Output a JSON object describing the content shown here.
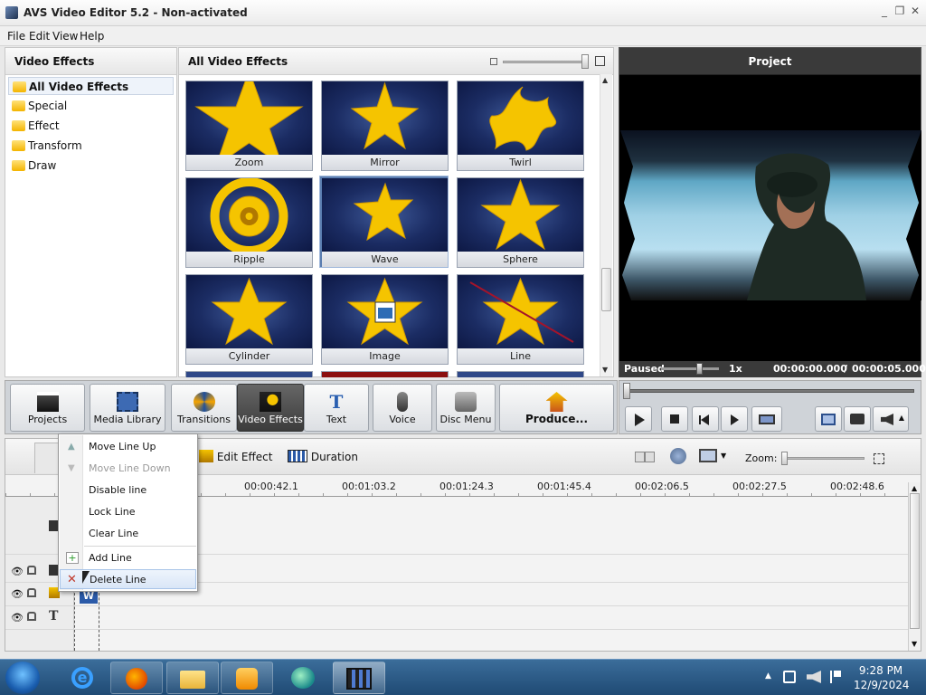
{
  "window": {
    "title": "AVS Video Editor 5.2 - Non-activated",
    "controls": [
      "minimize-icon",
      "restore-icon",
      "close-icon"
    ]
  },
  "menu": {
    "items": [
      "File",
      "Edit",
      "View",
      "Help"
    ]
  },
  "left_panel": {
    "header": "Video Effects",
    "items": [
      {
        "label": "All Video Effects",
        "selected": true
      },
      {
        "label": "Special"
      },
      {
        "label": "Effect"
      },
      {
        "label": "Transform"
      },
      {
        "label": "Draw"
      }
    ]
  },
  "effects_panel": {
    "header": "All Video Effects",
    "tiles": [
      {
        "label": "Zoom"
      },
      {
        "label": "Mirror"
      },
      {
        "label": "Twirl"
      },
      {
        "label": "Ripple"
      },
      {
        "label": "Wave",
        "selected": true
      },
      {
        "label": "Sphere"
      },
      {
        "label": "Cylinder"
      },
      {
        "label": "Image"
      },
      {
        "label": "Line"
      }
    ]
  },
  "preview": {
    "header": "Project",
    "status": "Paused",
    "speed": "1x",
    "time_current": "00:00:00.000",
    "time_separator": "/",
    "time_total": "00:00:05.000"
  },
  "toolbar": {
    "buttons": [
      {
        "label": "Projects",
        "icon": "clapper-icon"
      },
      {
        "label": "Media Library",
        "icon": "film-icon"
      },
      {
        "label": "Transitions",
        "icon": "transitions-icon"
      },
      {
        "label": "Video Effects",
        "icon": "effects-icon",
        "active": true
      },
      {
        "label": "Text",
        "icon": "text-icon"
      },
      {
        "label": "Voice",
        "icon": "microphone-icon"
      },
      {
        "label": "Disc Menu",
        "icon": "disc-icon"
      },
      {
        "label": "Produce...",
        "icon": "produce-icon"
      }
    ]
  },
  "player_controls": [
    "play-icon",
    "stop-icon",
    "previous-icon",
    "next-icon",
    "aspect-icon",
    "fullscreen-icon",
    "snapshot-icon",
    "volume-icon"
  ],
  "timeline": {
    "toolbar": {
      "edit_effect": "Edit Effect",
      "duration": "Duration",
      "zoom_label": "Zoom:"
    },
    "ruler": [
      "00:00:42.1",
      "00:01:03.2",
      "00:01:24.3",
      "00:01:45.4",
      "00:02:06.5",
      "00:02:27.5",
      "00:02:48.6"
    ],
    "clip_label": "W"
  },
  "context_menu": {
    "items": [
      {
        "label": "Move Line Up"
      },
      {
        "label": "Move Line Down",
        "disabled": true
      },
      {
        "label": "Disable line"
      },
      {
        "label": "Lock Line"
      },
      {
        "label": "Clear Line"
      },
      {
        "label": "Add Line",
        "icon": "add-icon"
      },
      {
        "label": "Delete Line",
        "icon": "delete-icon",
        "highlighted": true
      }
    ]
  },
  "taskbar": {
    "apps": [
      "ie-icon",
      "firefox-icon",
      "explorer-icon",
      "media-player-icon",
      "app-icon",
      "avs-video-editor-icon"
    ],
    "time": "9:28 PM",
    "date": "12/9/2024"
  },
  "colors": {
    "accent": "#5a7db0",
    "panel_dark": "#3a3a3a",
    "taskbar": "#2b5a85",
    "star": "#f5c400"
  }
}
